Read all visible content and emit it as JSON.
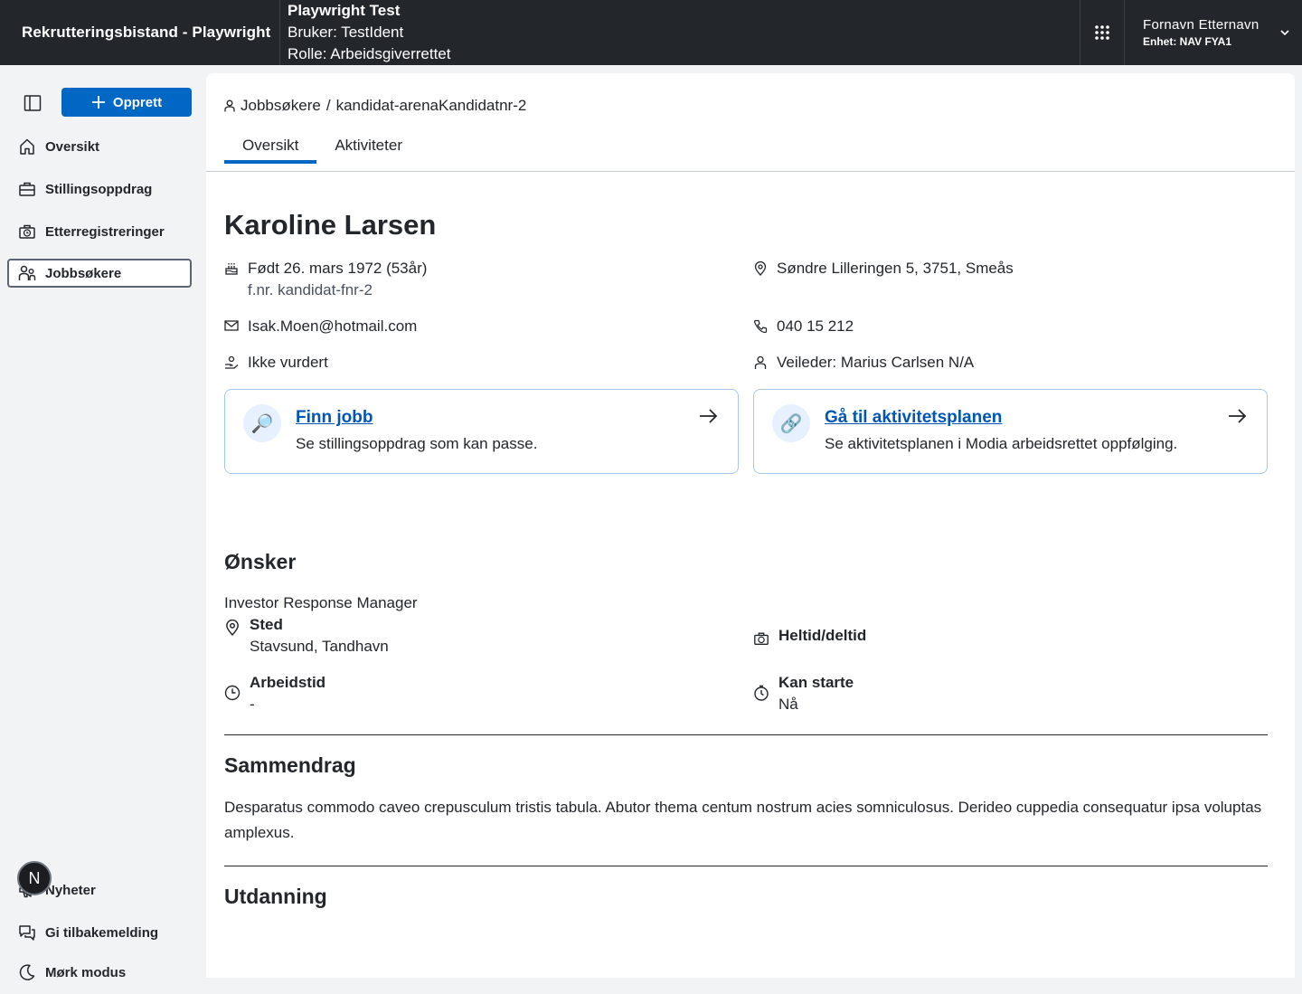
{
  "header": {
    "app_title": "Rekrutteringsbistand - Playwright",
    "env_title": "Playwright Test",
    "env_user": "Bruker: TestIdent",
    "env_role": "Rolle: Arbeidsgiverrettet",
    "user_name": "Fornavn Etternavn",
    "user_unit": "Enhet: NAV FYA1"
  },
  "sidebar": {
    "create_label": "Opprett",
    "items": [
      {
        "label": "Oversikt",
        "icon": "house-icon"
      },
      {
        "label": "Stillingsoppdrag",
        "icon": "briefcase-icon"
      },
      {
        "label": "Etterregistreringer",
        "icon": "briefcase-clock-icon"
      },
      {
        "label": "Jobbsøkere",
        "icon": "persons-icon",
        "active": true
      }
    ],
    "bottom": [
      {
        "label": "Nyheter",
        "icon": "megaphone-icon"
      },
      {
        "label": "Gi tilbakemelding",
        "icon": "chat-icon"
      },
      {
        "label": "Mørk modus",
        "icon": "moon-icon"
      }
    ],
    "badge": "N"
  },
  "breadcrumb": {
    "parent": "Jobbsøkere",
    "separator": "/",
    "current": "kandidat-arenaKandidatnr-2"
  },
  "tabs": [
    {
      "label": "Oversikt",
      "active": true
    },
    {
      "label": "Aktiviteter",
      "active": false
    }
  ],
  "candidate": {
    "name": "Karoline Larsen",
    "born": "Født 26. mars 1972 (53år)",
    "fnr": "f.nr. kandidat-fnr-2",
    "address": "Søndre Lilleringen 5, 3751, Smeås",
    "email": "Isak.Moen@hotmail.com",
    "phone": "040 15 212",
    "assessment": "Ikke vurdert",
    "supervisor": "Veileder: Marius Carlsen N/A"
  },
  "cards": [
    {
      "title": "Finn jobb",
      "desc": "Se stillingsoppdrag som kan passe.",
      "icon": "magnifier-icon"
    },
    {
      "title": "Gå til aktivitetsplanen",
      "desc": "Se aktivitetsplanen i Modia arbeidsrettet oppfølging.",
      "icon": "link-icon"
    }
  ],
  "wishes": {
    "heading": "Ønsker",
    "job": "Investor Response Manager",
    "place_label": "Sted",
    "place_value": "Stavsund, Tandhavn",
    "fulltime_label": "Heltid/deltid",
    "worktime_label": "Arbeidstid",
    "worktime_value": "-",
    "start_label": "Kan starte",
    "start_value": "Nå"
  },
  "summary": {
    "heading": "Sammendrag",
    "text": "Desparatus commodo caveo crepusculum tristis tabula. Abutor thema centum nostrum acies somniculosus. Derideo cuppedia consequatur ipsa voluptas amplexus."
  },
  "education": {
    "heading": "Utdanning"
  },
  "colors": {
    "header_bg": "#23262a",
    "accent": "#0067c5",
    "link": "#0056b4",
    "card_border": "#a8c7ea"
  }
}
